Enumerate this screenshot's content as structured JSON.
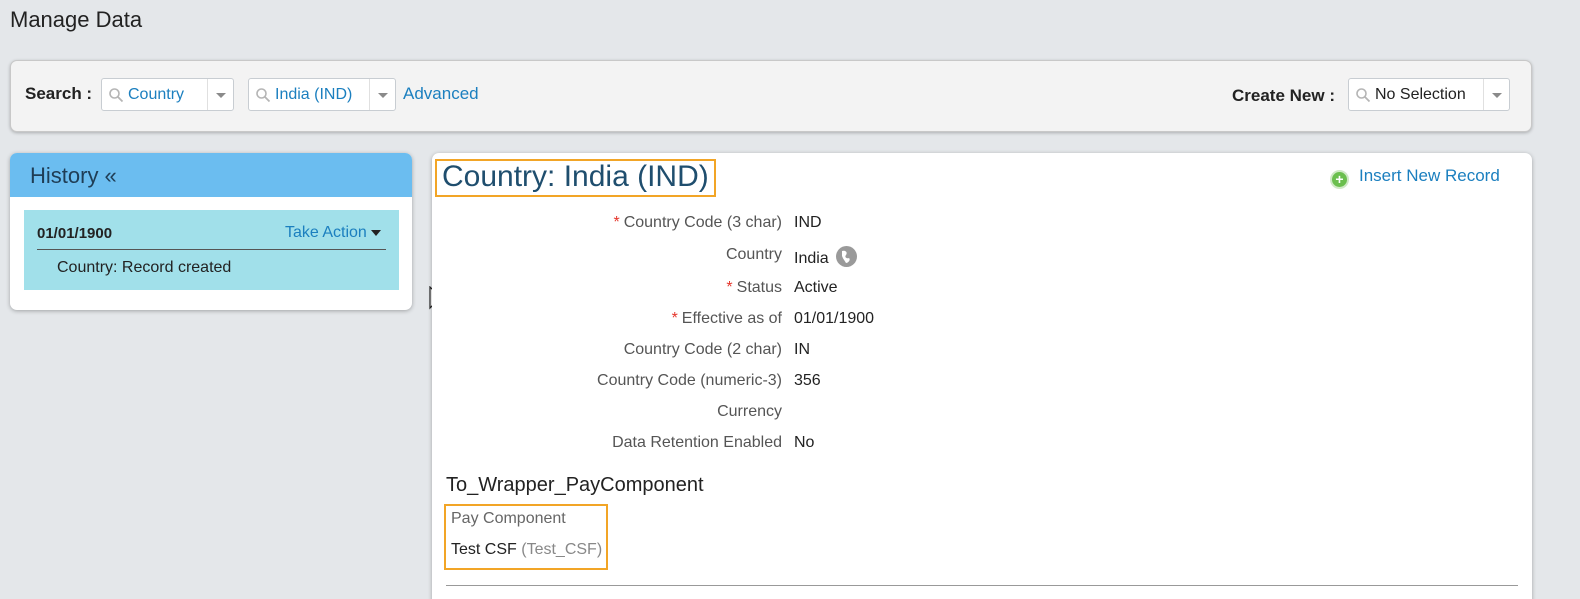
{
  "page": {
    "title": "Manage Data"
  },
  "search": {
    "label": "Search :",
    "type_value": "Country",
    "record_value": "India (IND)",
    "advanced_label": "Advanced",
    "create_label": "Create New :",
    "create_value": "No Selection"
  },
  "history": {
    "title": "History «",
    "items": [
      {
        "date": "01/01/1900",
        "action_label": "Take Action",
        "description": "Country: Record created"
      }
    ]
  },
  "record": {
    "title": "Country: India (IND)",
    "insert_label": "Insert New Record",
    "fields": [
      {
        "label": "Country Code (3 char)",
        "value": "IND",
        "required": "*"
      },
      {
        "label": "Country",
        "value": "India",
        "required": ""
      },
      {
        "label": "Status",
        "value": "Active",
        "required": "*"
      },
      {
        "label": "Effective as of",
        "value": "01/01/1900",
        "required": "*"
      },
      {
        "label": "Country Code (2 char)",
        "value": "IN",
        "required": ""
      },
      {
        "label": "Country Code (numeric-3)",
        "value": "356",
        "required": ""
      },
      {
        "label": "Currency",
        "value": "",
        "required": ""
      },
      {
        "label": "Data Retention Enabled",
        "value": "No",
        "required": ""
      }
    ],
    "section_title": "To_Wrapper_PayComponent",
    "pay_component": {
      "label": "Pay Component",
      "name": "Test CSF",
      "code": "(Test_CSF)"
    }
  },
  "colors": {
    "accent": "#1b7fbf",
    "highlight_border": "#f2a526",
    "history_header": "#6bbdf0",
    "history_item": "#a1e0ea",
    "required": "#e5352b"
  },
  "icons": [
    "search-icon",
    "dropdown-arrow-icon",
    "caret-down-icon",
    "plus-circle-icon",
    "globe-icon",
    "mouse-cursor-icon"
  ]
}
